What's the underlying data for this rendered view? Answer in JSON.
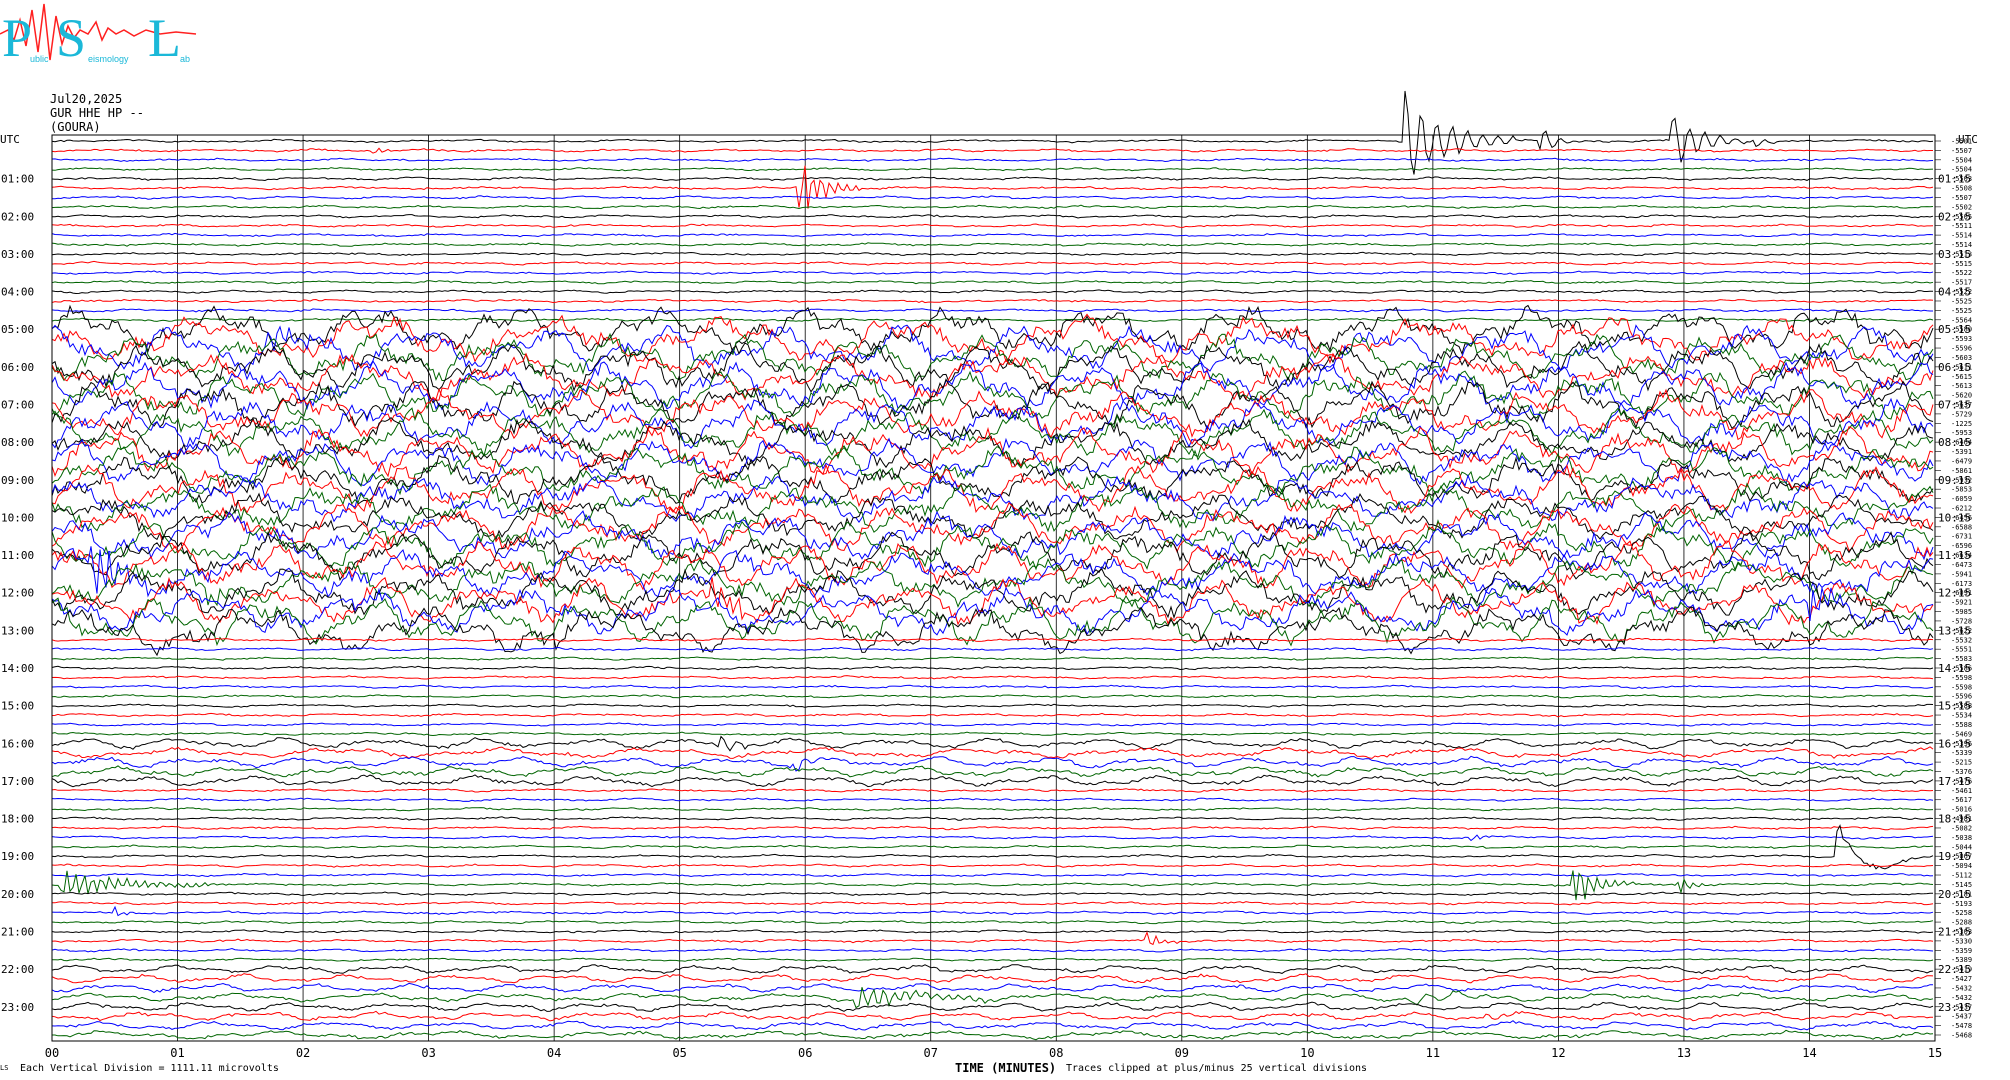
{
  "header": {
    "date": "Jul20,2025",
    "station": "GUR HHE HP --",
    "site": "(GOURA)"
  },
  "logo": {
    "letters": [
      "P",
      "S",
      "L"
    ],
    "small_words": [
      "ublic",
      "eismology",
      "ab"
    ],
    "colors": {
      "letters": "#1bb8d8",
      "wave": "#ff2020"
    }
  },
  "footer": {
    "left_mark": "LS",
    "division_note": "Each Vertical Division = 1111.11 microvolts",
    "time_label": "TIME (MINUTES)",
    "clip_note": "Traces clipped at plus/minus 25 vertical divisions"
  },
  "chart_data": {
    "type": "line",
    "title": "",
    "xlabel": "TIME (MINUTES)",
    "xlim": [
      0,
      15
    ],
    "x_ticks": [
      "00",
      "01",
      "02",
      "03",
      "04",
      "05",
      "06",
      "07",
      "08",
      "09",
      "10",
      "11",
      "12",
      "13",
      "14",
      "15"
    ],
    "left_axis_top_label": "UTC",
    "right_axis_top_label": "UTC",
    "left_hour_labels": [
      "01:00",
      "02:00",
      "03:00",
      "04:00",
      "05:00",
      "06:00",
      "07:00",
      "08:00",
      "09:00",
      "10:00",
      "11:00",
      "12:00",
      "13:00",
      "14:00",
      "15:00",
      "16:00",
      "17:00",
      "18:00",
      "19:00",
      "20:00",
      "21:00",
      "22:00",
      "23:00"
    ],
    "right_hour_labels": [
      "01:15",
      "02:15",
      "03:15",
      "04:15",
      "05:15",
      "06:15",
      "07:15",
      "08:15",
      "09:15",
      "10:15",
      "11:15",
      "12:15",
      "13:15",
      "14:15",
      "15:15",
      "16:15",
      "17:15",
      "18:15",
      "19:15",
      "20:15",
      "21:15",
      "22:15",
      "23:15"
    ],
    "trace_colors": [
      "#000000",
      "#ff0000",
      "#0000ff",
      "#006400"
    ],
    "rows_per_hour": 4,
    "row_count": 96,
    "trace_values": [
      "-5501",
      "-5507",
      "-5504",
      "-5504",
      "-5503",
      "-5508",
      "-5507",
      "-5502",
      "-5505",
      "-5511",
      "-5514",
      "-5514",
      "-5513",
      "-5515",
      "-5522",
      "-5517",
      "-5522",
      "-5525",
      "-5525",
      "-5564",
      "-5580",
      "-5593",
      "-5596",
      "-5603",
      "-5611",
      "-5615",
      "-5613",
      "-5620",
      "-5637",
      "-5729",
      "-1225",
      "-5953",
      "-6464",
      "-5391",
      "-6479",
      "-5861",
      "-5932",
      "-5853",
      "-6059",
      "-6212",
      "-6456",
      "-6588",
      "-6731",
      "-6596",
      "-6634",
      "-6473",
      "-5941",
      "-6173",
      "-6091",
      "-5921",
      "-5985",
      "-5728",
      "-5622",
      "-5532",
      "-5551",
      "-5583",
      "-5586",
      "-5598",
      "-5598",
      "-5596",
      "-5588",
      "-5534",
      "-5588",
      "-5469",
      "-5396",
      "-5339",
      "-5215",
      "-5376",
      "-5476",
      "-5461",
      "-5617",
      "-5016",
      "-4981",
      "-5082",
      "-5038",
      "-5044",
      "-5067",
      "-5094",
      "-5112",
      "-5145",
      "-5181",
      "-5193",
      "-5258",
      "-5288",
      "-5303",
      "-5330",
      "-5359",
      "-5389",
      "-5419",
      "-5427",
      "-5432",
      "-5432",
      "-5437",
      "-5437",
      "-5478",
      "-5468"
    ],
    "events": [
      {
        "row": 0,
        "minute": 10.75,
        "amp": 60,
        "dur": 0.9,
        "freq": 14
      },
      {
        "row": 0,
        "minute": 11.85,
        "amp": 18,
        "dur": 0.3,
        "freq": 14
      },
      {
        "row": 0,
        "minute": 12.9,
        "amp": 35,
        "dur": 0.6,
        "freq": 14
      },
      {
        "row": 0,
        "minute": 13.55,
        "amp": 8,
        "dur": 0.3,
        "freq": 14
      },
      {
        "row": 1,
        "minute": 2.55,
        "amp": 8,
        "dur": 0.2,
        "freq": 16
      },
      {
        "row": 5,
        "minute": 5.95,
        "amp": 40,
        "dur": 0.5,
        "freq": 16
      },
      {
        "row": 22,
        "minute": 1.7,
        "amp": 14,
        "dur": 1.0,
        "freq": 10
      },
      {
        "row": 24,
        "minute": 6.2,
        "amp": 6,
        "dur": 0.6,
        "freq": 12
      },
      {
        "row": 46,
        "minute": 0.3,
        "amp": 40,
        "dur": 0.7,
        "freq": 16
      },
      {
        "row": 49,
        "minute": 5.25,
        "amp": 22,
        "dur": 0.5,
        "freq": 16
      },
      {
        "row": 47,
        "minute": 1.2,
        "amp": 12,
        "dur": 0.3,
        "freq": 16
      },
      {
        "row": 50,
        "minute": 14.0,
        "amp": 30,
        "dur": 0.4,
        "freq": 16
      },
      {
        "row": 52,
        "minute": 3.95,
        "amp": 8,
        "dur": 0.3,
        "freq": 16
      },
      {
        "row": 64,
        "minute": 5.3,
        "amp": 12,
        "dur": 0.5,
        "freq": 14
      },
      {
        "row": 66,
        "minute": 5.9,
        "amp": 10,
        "dur": 0.4,
        "freq": 14
      },
      {
        "row": 74,
        "minute": 11.3,
        "amp": 6,
        "dur": 0.3,
        "freq": 16
      },
      {
        "row": 76,
        "minute": 14.2,
        "amp": 60,
        "dur": 0.8,
        "freq": 22
      },
      {
        "row": 79,
        "minute": 0.05,
        "amp": 18,
        "dur": 1.4,
        "freq": 16
      },
      {
        "row": 79,
        "minute": 12.1,
        "amp": 30,
        "dur": 0.5,
        "freq": 16
      },
      {
        "row": 79,
        "minute": 12.95,
        "amp": 12,
        "dur": 0.3,
        "freq": 16
      },
      {
        "row": 82,
        "minute": 0.5,
        "amp": 6,
        "dur": 0.2,
        "freq": 16
      },
      {
        "row": 85,
        "minute": 8.7,
        "amp": 14,
        "dur": 0.3,
        "freq": 16
      },
      {
        "row": 91,
        "minute": 6.4,
        "amp": 14,
        "dur": 1.3,
        "freq": 10
      },
      {
        "row": 91,
        "minute": 10.8,
        "amp": 8,
        "dur": 1.3,
        "freq": 18
      },
      {
        "row": 93,
        "minute": 11.4,
        "amp": 5,
        "dur": 0.3,
        "freq": 14
      }
    ],
    "noise_bands": [
      {
        "from_row": 20,
        "to_row": 52,
        "amp": 22
      },
      {
        "from_row": 64,
        "to_row": 68,
        "amp": 5
      },
      {
        "from_row": 88,
        "to_row": 95,
        "amp": 4
      }
    ]
  }
}
